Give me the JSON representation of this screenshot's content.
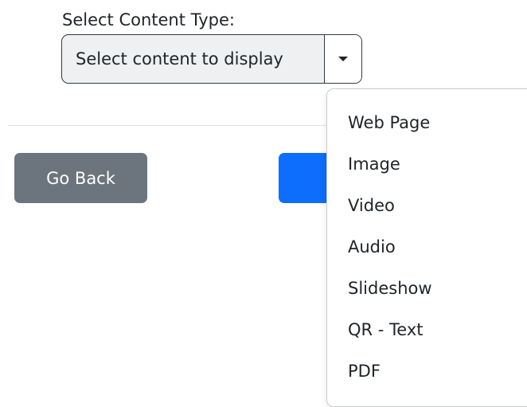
{
  "form": {
    "label": "Select Content Type:",
    "select": {
      "value": "Select content to display",
      "toggle_icon": "caret-down-icon"
    }
  },
  "buttons": {
    "back_label": "Go Back",
    "back_color": "#6c757d",
    "primary_color": "#0d6efd"
  },
  "dropdown": {
    "items": [
      {
        "label": "Web Page"
      },
      {
        "label": "Image"
      },
      {
        "label": "Video"
      },
      {
        "label": "Audio"
      },
      {
        "label": "Slideshow"
      },
      {
        "label": "QR - Text"
      },
      {
        "label": "PDF"
      }
    ]
  }
}
